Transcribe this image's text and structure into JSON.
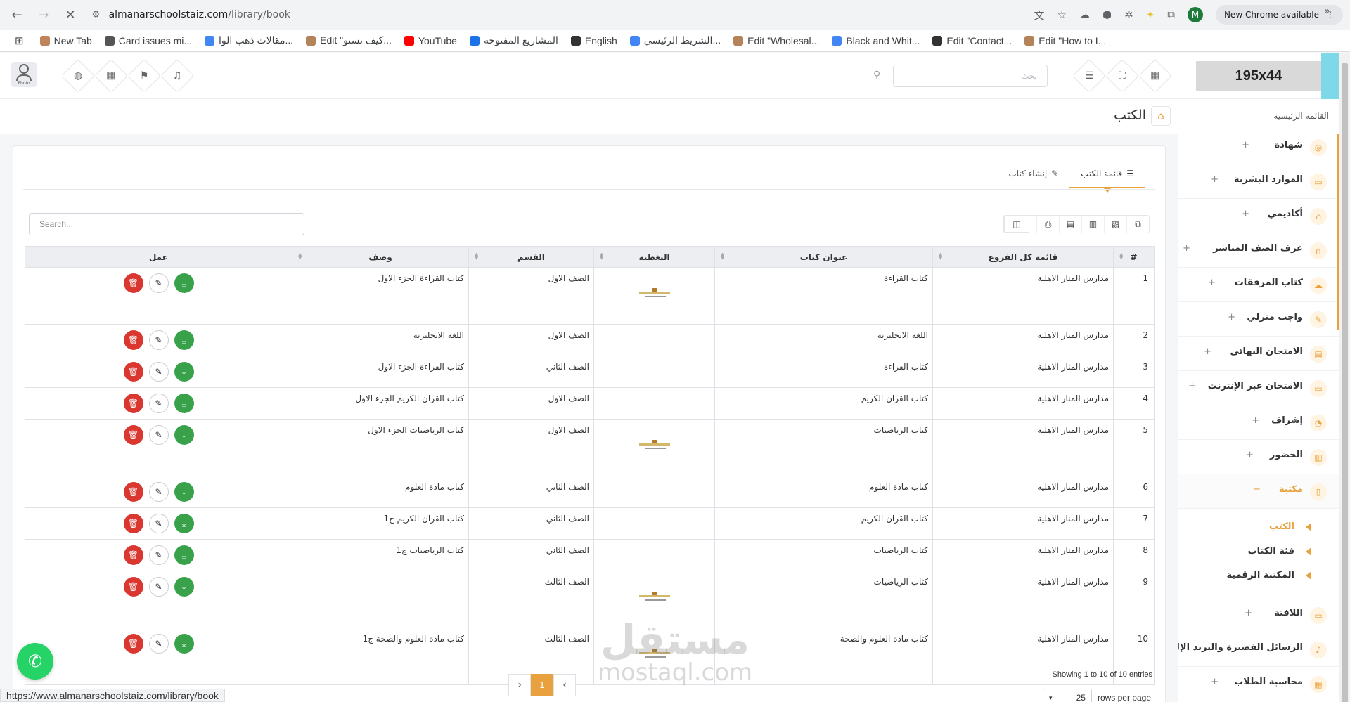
{
  "browser": {
    "url_host": "almanarschoolstaiz.com",
    "url_path": "/library/book",
    "profile_initial": "M",
    "new_chrome_label": "New Chrome available",
    "status_url": "https://www.almanarschoolstaiz.com/library/book"
  },
  "bookmarks": [
    {
      "label": "New Tab",
      "color": "#c0845a"
    },
    {
      "label": "Card issues mi...",
      "color": "#555555"
    },
    {
      "label": "مقالات ذهب الوا...",
      "color": "#4285f4"
    },
    {
      "label": "Edit \"كيف تستو...",
      "color": "#b5835a"
    },
    {
      "label": "YouTube",
      "color": "#ff0000"
    },
    {
      "label": "المشاريع المفتوحة",
      "color": "#1a73e8"
    },
    {
      "label": "English",
      "color": "#333333"
    },
    {
      "label": "الشريط الرئيسي...",
      "color": "#4285f4"
    },
    {
      "label": "Edit \"Wholesal...",
      "color": "#b5835a"
    },
    {
      "label": "Black and Whit...",
      "color": "#4285f4"
    },
    {
      "label": "Edit \"Contact...",
      "color": "#333333"
    },
    {
      "label": "Edit \"How to I...",
      "color": "#b5835a"
    }
  ],
  "header": {
    "logo_text": "195x44",
    "search_placeholder": "بحث",
    "avatar_tag": "Photo"
  },
  "breadcrumb": {
    "page_title": "الكتب",
    "main_menu": "القائمة الرئيسية"
  },
  "sidebar": {
    "items": [
      {
        "label": "شهادة",
        "icon": "certificate-icon",
        "glyph": "◎"
      },
      {
        "label": "الموارد البشرية",
        "icon": "monitor-icon",
        "glyph": "▭"
      },
      {
        "label": "أكاديمي",
        "icon": "home-icon",
        "glyph": "⌂"
      },
      {
        "label": "غرف الصف المباشر",
        "icon": "headset-icon",
        "glyph": "∩"
      },
      {
        "label": "كتاب المرفقات",
        "icon": "cloud-upload-icon",
        "glyph": "☁"
      },
      {
        "label": "واجب منزلي",
        "icon": "edit-icon",
        "glyph": "✎"
      },
      {
        "label": "الامتحان النهائي",
        "icon": "book-icon",
        "glyph": "▤"
      },
      {
        "label": "الامتحان عبر الإنترنت",
        "icon": "desktop-icon",
        "glyph": "▭"
      },
      {
        "label": "إشراف",
        "icon": "rss-icon",
        "glyph": "◔"
      },
      {
        "label": "الحضور",
        "icon": "bar-chart-icon",
        "glyph": "▥"
      },
      {
        "label": "مكتبة",
        "icon": "library-icon",
        "glyph": "▯"
      }
    ],
    "subitems": [
      "الكتب",
      "فئة الكتاب",
      "المكتبة الرقمية"
    ],
    "items_after": [
      {
        "label": "اللافتة",
        "icon": "banner-icon",
        "glyph": "▭"
      },
      {
        "label": "الرسائل القصيرة والبريد الإلكتروني",
        "icon": "bell-icon",
        "glyph": "♪"
      },
      {
        "label": "محاسبة الطلاب",
        "icon": "calculator-icon",
        "glyph": "▦"
      }
    ]
  },
  "tabs": {
    "list": "قائمة الكتب",
    "create": "إنشاء كتاب"
  },
  "table": {
    "search_placeholder": "Search...",
    "headers": [
      "#",
      "قائمة كل الفروع",
      "عنوان كتاب",
      "التغطية",
      "القسم",
      "وصف",
      "عمل"
    ],
    "rows": [
      {
        "num": "1",
        "branch": "مدارس المنار الاهلية",
        "title": "كتاب القراءة",
        "cover": true,
        "section": "الصف الاول",
        "desc": "كتاب القراءة الجزء الاول"
      },
      {
        "num": "2",
        "branch": "مدارس المنار الاهلية",
        "title": "اللغة الانجليزية",
        "cover": false,
        "section": "الصف الاول",
        "desc": "اللغة الانجليزية"
      },
      {
        "num": "3",
        "branch": "مدارس المنار الاهلية",
        "title": "كتاب القراءة",
        "cover": false,
        "section": "الصف الثاني",
        "desc": "كتاب القراءة الجزء الاول"
      },
      {
        "num": "4",
        "branch": "مدارس المنار الاهلية",
        "title": "كتاب القران الكريم",
        "cover": false,
        "section": "الصف الاول",
        "desc": "كتاب القران الكريم الجزء الاول"
      },
      {
        "num": "5",
        "branch": "مدارس المنار الاهلية",
        "title": "كتاب الرياضيات",
        "cover": true,
        "section": "الصف الاول",
        "desc": "كتاب الرياضيات الجزء الاول"
      },
      {
        "num": "6",
        "branch": "مدارس المنار الاهلية",
        "title": "كتاب مادة العلوم",
        "cover": false,
        "section": "الصف الثاني",
        "desc": "كتاب مادة العلوم"
      },
      {
        "num": "7",
        "branch": "مدارس المنار الاهلية",
        "title": "كتاب القران الكريم",
        "cover": false,
        "section": "الصف الثاني",
        "desc": "كتاب القران الكريم ج1"
      },
      {
        "num": "8",
        "branch": "مدارس المنار الاهلية",
        "title": "كتاب الرياضيات",
        "cover": false,
        "section": "الصف الثاني",
        "desc": "كتاب الرياضيات ج1"
      },
      {
        "num": "9",
        "branch": "مدارس المنار الاهلية",
        "title": "كتاب الرياضيات",
        "cover": true,
        "section": "الصف الثالث",
        "desc": ""
      },
      {
        "num": "10",
        "branch": "مدارس المنار الاهلية",
        "title": "كتاب مادة العلوم والصحة",
        "cover": true,
        "section": "الصف الثالث",
        "desc": "كتاب مادة العلوم والصحة ج1"
      }
    ],
    "showing": "Showing 1 to 10 of 10 entries",
    "current_page": "1",
    "rows_per_page_label": "rows per page",
    "rows_per_page_value": "25"
  },
  "watermark": {
    "arabic": "مستقل",
    "latin": "mostaql.com"
  },
  "colors": {
    "accent": "#e8a13c",
    "delete": "#d9372f",
    "download": "#3aa14b",
    "whatsapp": "#25d366"
  }
}
